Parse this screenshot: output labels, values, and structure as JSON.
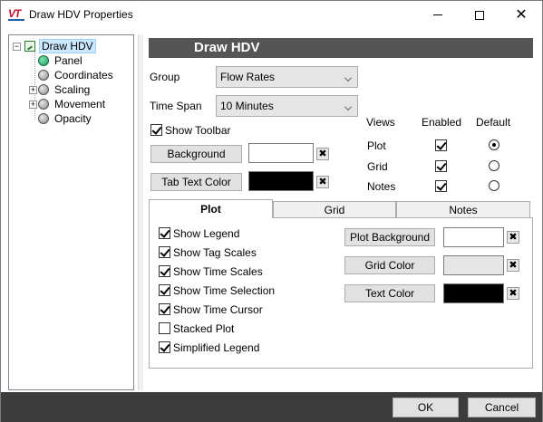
{
  "window": {
    "title": "Draw HDV Properties",
    "logo_text": "VT"
  },
  "tree": {
    "root": "Draw HDV",
    "items": [
      {
        "label": "Panel",
        "expandable": false,
        "active": true
      },
      {
        "label": "Coordinates",
        "expandable": false,
        "active": false
      },
      {
        "label": "Scaling",
        "expandable": true,
        "active": false
      },
      {
        "label": "Movement",
        "expandable": true,
        "active": false
      },
      {
        "label": "Opacity",
        "expandable": false,
        "active": false
      }
    ]
  },
  "header": {
    "title": "Draw HDV"
  },
  "form": {
    "group_label": "Group",
    "group_value": "Flow Rates",
    "timespan_label": "Time Span",
    "timespan_value": "10 Minutes",
    "show_toolbar_label": "Show Toolbar",
    "show_toolbar_checked": true,
    "background_label": "Background",
    "background_color": "#ffffff",
    "tab_text_color_label": "Tab Text Color",
    "tab_text_color": "#000000"
  },
  "views": {
    "col_views": "Views",
    "col_enabled": "Enabled",
    "col_default": "Default",
    "rows": [
      {
        "label": "Plot",
        "enabled": true,
        "default": true
      },
      {
        "label": "Grid",
        "enabled": true,
        "default": false
      },
      {
        "label": "Notes",
        "enabled": true,
        "default": false
      }
    ]
  },
  "tabs": [
    {
      "label": "Plot",
      "active": true
    },
    {
      "label": "Grid",
      "active": false
    },
    {
      "label": "Notes",
      "active": false
    }
  ],
  "plot_options": [
    {
      "label": "Show Legend",
      "checked": true
    },
    {
      "label": "Show Tag Scales",
      "checked": true
    },
    {
      "label": "Show Time Scales",
      "checked": true
    },
    {
      "label": "Show Time Selection",
      "checked": true
    },
    {
      "label": "Show Time Cursor",
      "checked": true
    },
    {
      "label": "Stacked Plot",
      "checked": false
    },
    {
      "label": "Simplified Legend",
      "checked": true
    }
  ],
  "plot_colors": [
    {
      "label": "Plot Background",
      "color": "#ffffff"
    },
    {
      "label": "Grid Color",
      "color": "#e6e6e6"
    },
    {
      "label": "Text Color",
      "color": "#000000"
    }
  ],
  "footer": {
    "ok_label": "OK",
    "cancel_label": "Cancel"
  },
  "icons": {
    "clear": "✖",
    "close": "✕"
  }
}
